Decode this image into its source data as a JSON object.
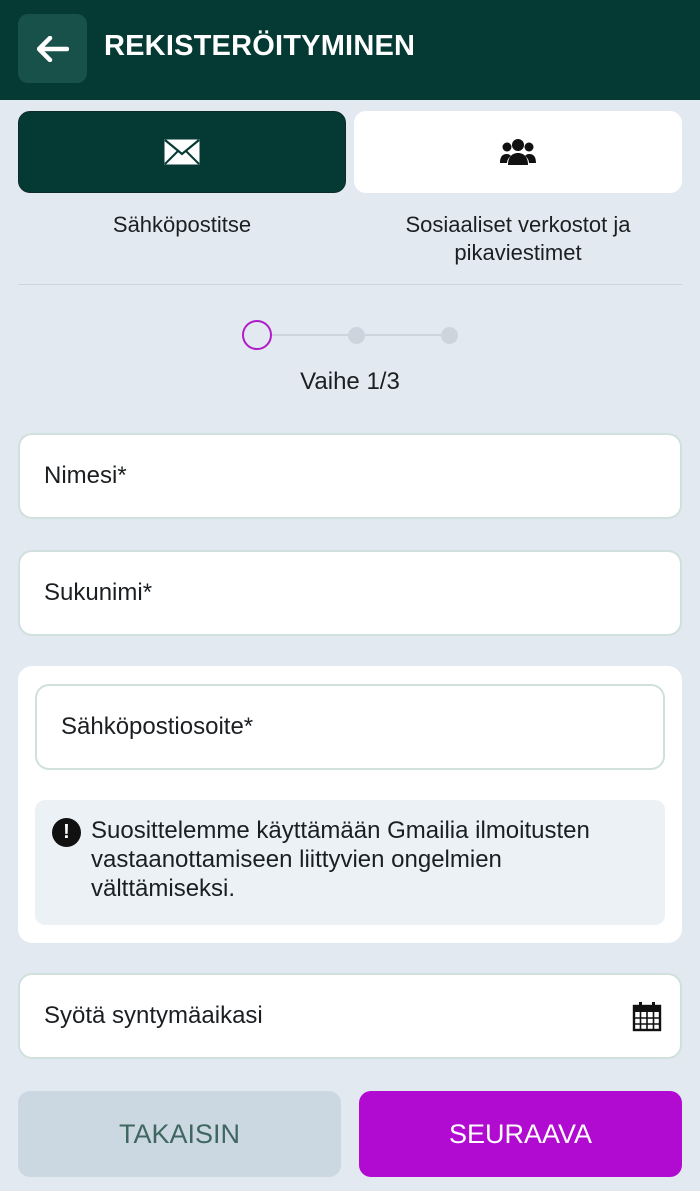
{
  "header": {
    "title": "REKISTERÖITYMINEN"
  },
  "methods": [
    {
      "icon": "envelope-icon",
      "label": "Sähköpostitse",
      "selected": true
    },
    {
      "icon": "users-icon",
      "label": "Sosiaaliset verkostot ja pikaviestimet",
      "selected": false
    }
  ],
  "stepper": {
    "current": 1,
    "total": 3,
    "text": "Vaihe 1/3"
  },
  "form": {
    "first_name_placeholder": "Nimesi*",
    "last_name_placeholder": "Sukunimi*",
    "email_placeholder": "Sähköpostiosoite*",
    "notice": "Suosittelemme käyttämään Gmailia ilmoitusten vastaanottamiseen liittyvien ongelmien välttämiseksi.",
    "birthdate_placeholder": "Syötä syntymäaikasi"
  },
  "buttons": {
    "back": "TAKAISIN",
    "next": "SEURAAVA"
  },
  "colors": {
    "header_bg": "#043a33",
    "accent": "#b10bd2",
    "page_bg": "#e3e9f1"
  }
}
